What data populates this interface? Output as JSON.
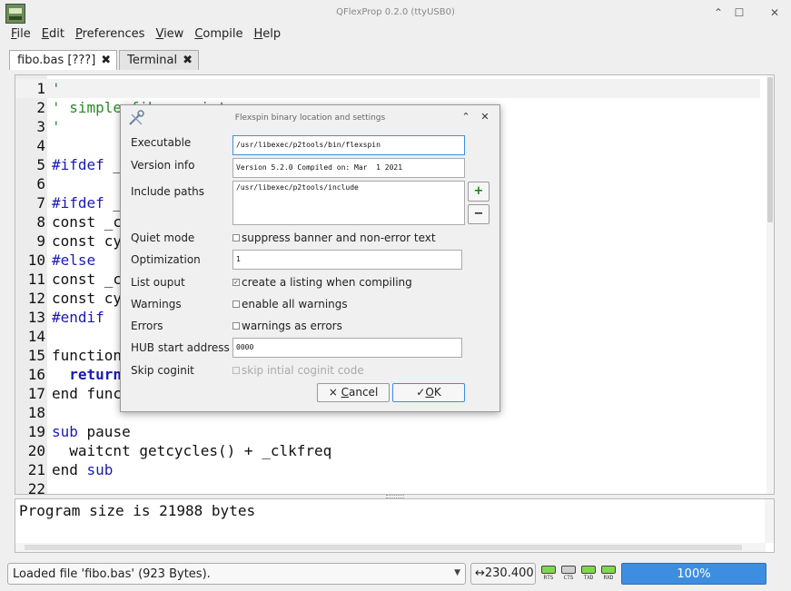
{
  "window": {
    "title": "QFlexProp 0.2.0 (ttyUSB0)",
    "minimize_glyph": "⌃",
    "maximize_glyph": "☐",
    "close_glyph": "✕"
  },
  "menu": [
    {
      "mnemonic": "F",
      "rest": "ile"
    },
    {
      "mnemonic": "E",
      "rest": "dit"
    },
    {
      "mnemonic": "P",
      "rest": "references"
    },
    {
      "mnemonic": "V",
      "rest": "iew"
    },
    {
      "mnemonic": "C",
      "rest": "ompile"
    },
    {
      "mnemonic": "H",
      "rest": "elp"
    }
  ],
  "tabs": [
    {
      "label": "fibo.bas [???]",
      "close": "✖"
    },
    {
      "label": "Terminal",
      "close": "✖"
    }
  ],
  "editor": {
    "lines": [
      {
        "n": "1",
        "segs": [
          {
            "t": "'",
            "c": "c-comment"
          }
        ]
      },
      {
        "n": "2",
        "segs": [
          {
            "t": "' simple fibo script",
            "c": "c-comment"
          }
        ]
      },
      {
        "n": "3",
        "segs": [
          {
            "t": "'",
            "c": "c-comment"
          }
        ]
      },
      {
        "n": "4",
        "segs": []
      },
      {
        "n": "5",
        "segs": [
          {
            "t": "#ifdef",
            "c": "c-kw"
          },
          {
            "t": " _",
            "c": ""
          }
        ]
      },
      {
        "n": "6",
        "segs": []
      },
      {
        "n": "7",
        "segs": [
          {
            "t": "#ifdef",
            "c": "c-kw"
          },
          {
            "t": " _",
            "c": ""
          }
        ]
      },
      {
        "n": "8",
        "segs": [
          {
            "t": "const _c",
            "c": ""
          }
        ]
      },
      {
        "n": "9",
        "segs": [
          {
            "t": "const cy",
            "c": ""
          }
        ]
      },
      {
        "n": "10",
        "segs": [
          {
            "t": "#else",
            "c": "c-kw"
          }
        ]
      },
      {
        "n": "11",
        "segs": [
          {
            "t": "const _c",
            "c": ""
          }
        ]
      },
      {
        "n": "12",
        "segs": [
          {
            "t": "const cy",
            "c": ""
          }
        ]
      },
      {
        "n": "13",
        "segs": [
          {
            "t": "#endif",
            "c": "c-kw"
          }
        ]
      },
      {
        "n": "14",
        "segs": []
      },
      {
        "n": "15",
        "segs": [
          {
            "t": "function",
            "c": ""
          }
        ]
      },
      {
        "n": "16",
        "segs": [
          {
            "t": "  ",
            "c": ""
          },
          {
            "t": "return",
            "c": "c-ret"
          }
        ]
      },
      {
        "n": "17",
        "segs": [
          {
            "t": "end func",
            "c": ""
          }
        ]
      },
      {
        "n": "18",
        "segs": []
      },
      {
        "n": "19",
        "segs": [
          {
            "t": "sub",
            "c": "c-kw"
          },
          {
            "t": " pause",
            "c": ""
          }
        ]
      },
      {
        "n": "20",
        "segs": [
          {
            "t": "  waitcnt getcycles() + _clkfreq",
            "c": ""
          }
        ]
      },
      {
        "n": "21",
        "segs": [
          {
            "t": "end ",
            "c": ""
          },
          {
            "t": "sub",
            "c": "c-kw"
          }
        ]
      },
      {
        "n": "22",
        "segs": []
      }
    ]
  },
  "output": {
    "text": "Program size is 21988 bytes"
  },
  "statusbar": {
    "message": "Loaded file 'fibo.bas' (923 Bytes).",
    "baud": "↔230.400",
    "leds": [
      {
        "label": "RTS",
        "color": "#7fd84a"
      },
      {
        "label": "CTS",
        "color": "#cfcfcf"
      },
      {
        "label": "TXD",
        "color": "#7fd84a"
      },
      {
        "label": "RXD",
        "color": "#7fd84a"
      }
    ],
    "progress_label": "100%",
    "progress_fraction": 1.0,
    "progress_color": "#3d8ee0"
  },
  "dialog": {
    "title": "Flexspin binary location and settings",
    "executable_label": "Executable",
    "executable_value": "/usr/libexec/p2tools/bin/flexspin",
    "version_label": "Version info",
    "version_value": "Version 5.2.0 Compiled on: Mar  1 2021",
    "include_label": "Include paths",
    "include_value": "/usr/libexec/p2tools/include",
    "add_glyph": "+",
    "remove_glyph": "−",
    "quiet_label": "Quiet mode",
    "quiet_text": "suppress banner and non-error text",
    "optimization_label": "Optimization",
    "optimization_value": "1",
    "listing_label": "List ouput",
    "listing_text": "create a listing when compiling",
    "warnings_label": "Warnings",
    "warnings_text": "enable all warnings",
    "errors_label": "Errors",
    "errors_text": "warnings as errors",
    "hub_label": "HUB start address",
    "hub_value": "0000",
    "coginit_label": "Skip coginit",
    "coginit_text": "skip intial coginit code",
    "cancel_icon": "×",
    "cancel_mnemonic": "C",
    "cancel_rest": "ancel",
    "ok_icon": "✓",
    "ok_mnemonic": "O",
    "ok_rest": "K",
    "check_mark": "✓"
  }
}
